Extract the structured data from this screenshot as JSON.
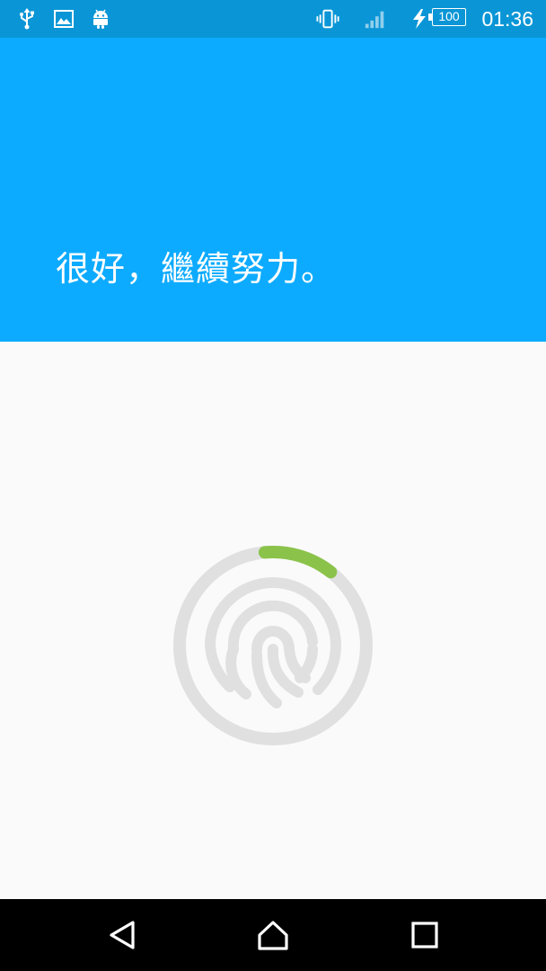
{
  "status_bar": {
    "icons_left": [
      "usb-icon",
      "image-icon",
      "android-icon"
    ],
    "icons_right": [
      "vibrate-icon",
      "signal-icon",
      "charging-icon"
    ],
    "battery_level": "100",
    "time": "01:36"
  },
  "header": {
    "title": "很好，繼續努力。",
    "background_color": "#0dabff"
  },
  "enrollment": {
    "progress": 0.12,
    "progress_color": "#8bc34a",
    "ring_color": "#e0e0e0"
  },
  "nav_bar": {
    "buttons": [
      "back-icon",
      "home-icon",
      "recents-icon"
    ]
  }
}
